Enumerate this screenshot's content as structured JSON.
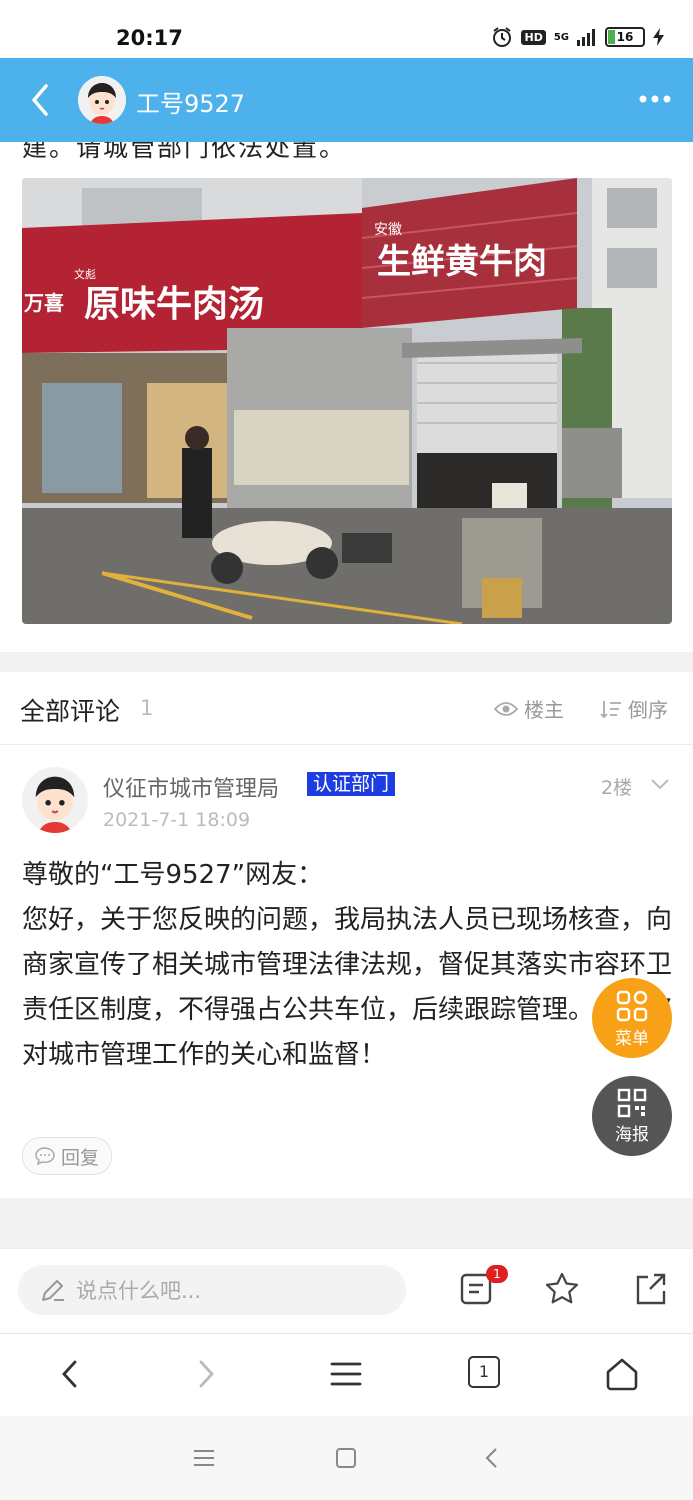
{
  "status_bar": {
    "time": "20:17",
    "network": "5G",
    "hd_label": "HD",
    "battery_level": "16"
  },
  "header": {
    "username": "工号9527",
    "back_icon": "chevron-left-icon",
    "more_icon": "more-dots-icon"
  },
  "post": {
    "text_tail": "建。请城管部门依法处置。",
    "photo_sign_left": "原味牛肉汤",
    "photo_sign_right": "生鲜黄牛肉",
    "photo_sign_right_small": "安徽",
    "photo_sign_left_small": "文彪",
    "photo_sign_far_left": "万喜"
  },
  "comments": {
    "title": "全部评论",
    "count": "1",
    "owner_only_label": "楼主",
    "reverse_order_label": "倒序",
    "items": [
      {
        "author": "仪征市城市管理局",
        "badge": "认证部门",
        "floor": "2楼",
        "date": "2021-7-1 18:09",
        "body": "尊敬的“工号9527”网友：\n您好，关于您反映的问题，我局执法人员已现场核查，向商家宣传了相关城市管理法律法规，督促其落实市容环卫责任区制度，不得强占公共车位，后续跟踪管理。感谢您对城市管理工作的关心和监督！",
        "reply_label": "回复"
      }
    ]
  },
  "floating": {
    "menu_label": "菜单",
    "poster_label": "海报"
  },
  "input_bar": {
    "placeholder": "说点什么吧...",
    "comment_badge": "1"
  },
  "browser_bar": {
    "tabs_count": "1"
  },
  "colors": {
    "header_bg": "#4db1ec",
    "badge_bg": "#1e3de0",
    "menu_fab": "#f8a116",
    "poster_fab": "#555555",
    "notify_red": "#e02020"
  }
}
